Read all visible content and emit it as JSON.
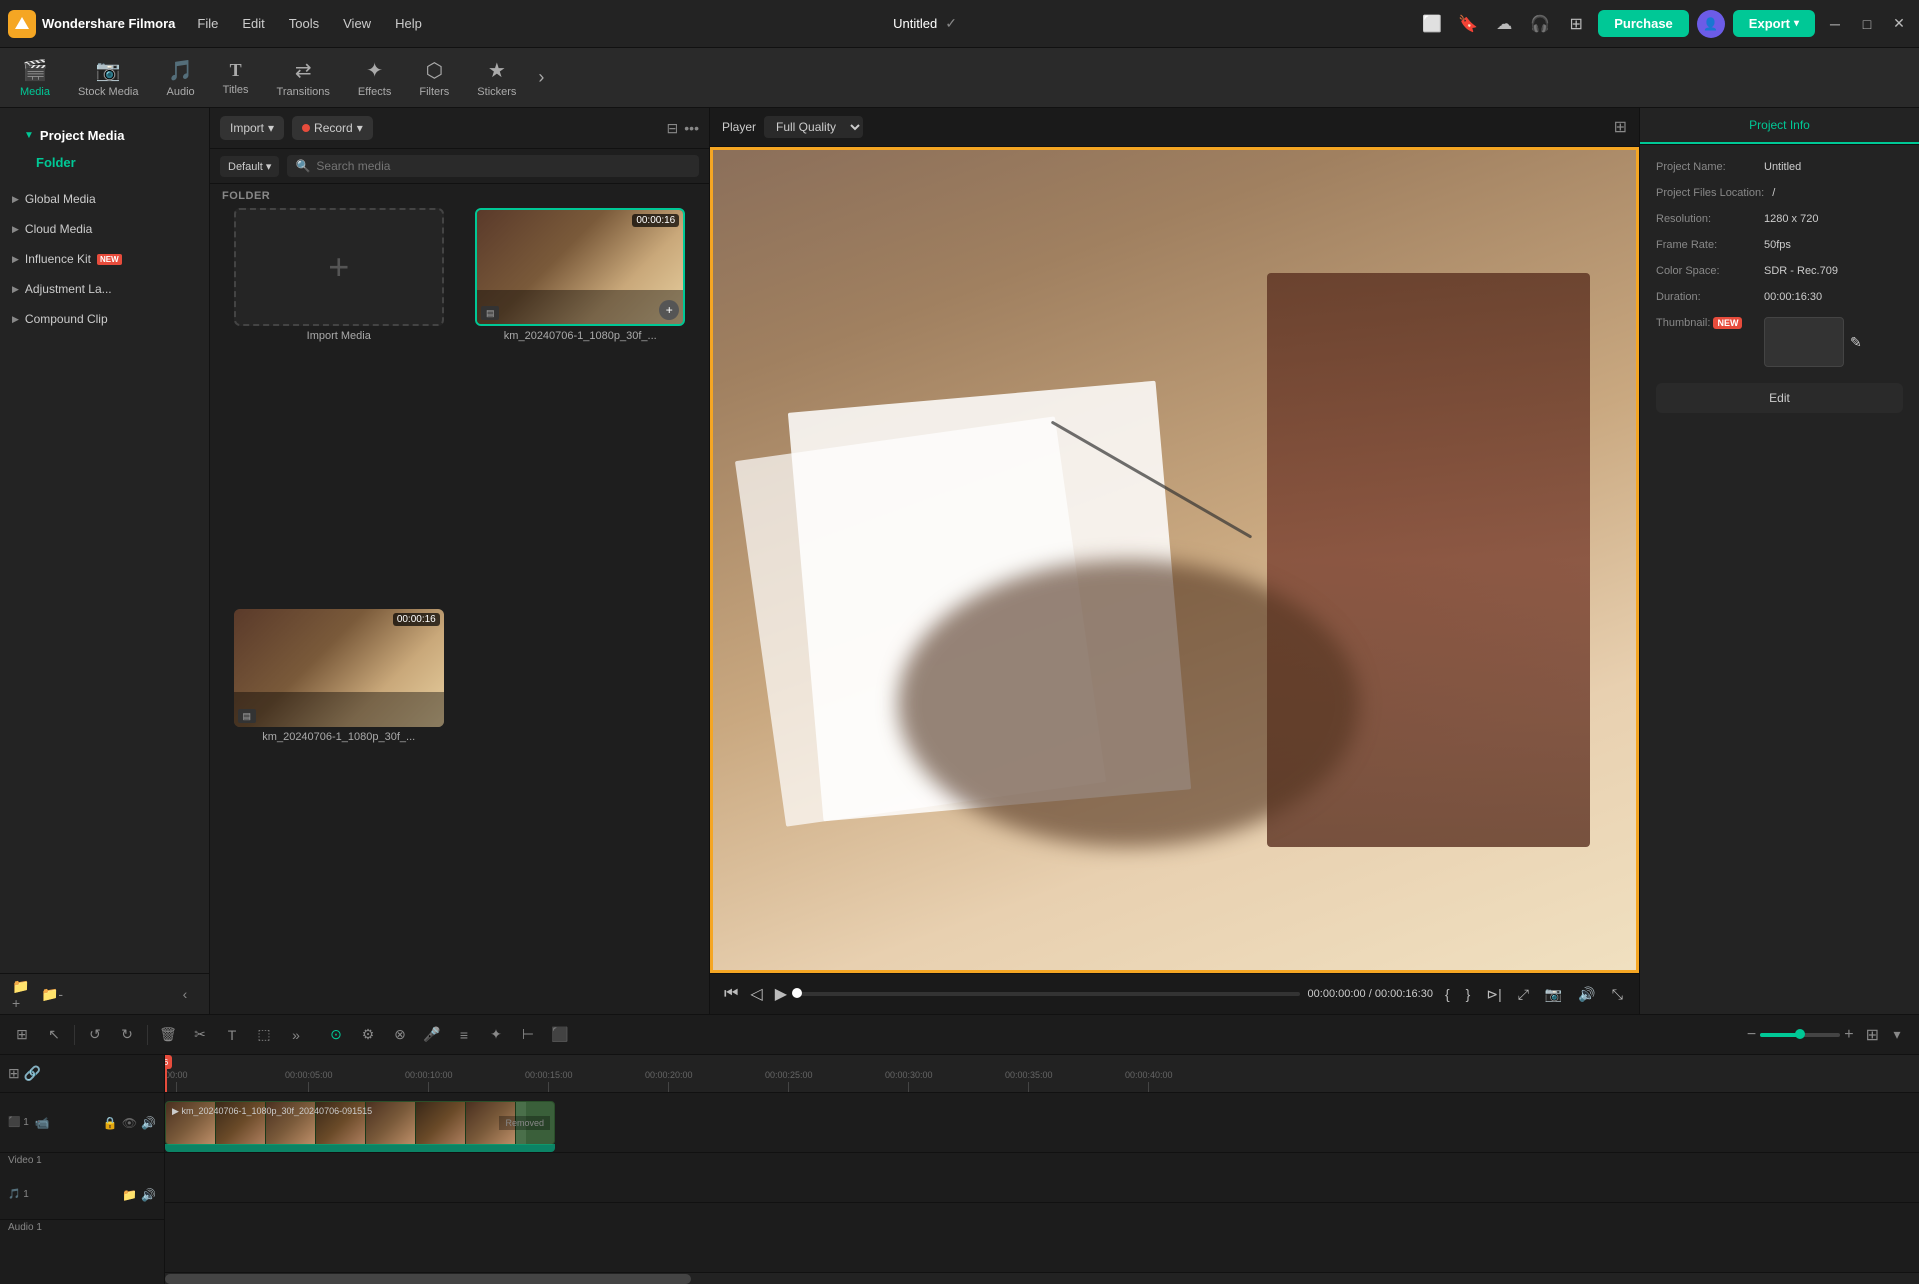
{
  "app": {
    "name": "Wondershare Filmora",
    "logo_letter": "F"
  },
  "menu": {
    "items": [
      "File",
      "Edit",
      "Tools",
      "View",
      "Help"
    ]
  },
  "title": {
    "project_name": "Untitled"
  },
  "topbar_right": {
    "purchase_label": "Purchase",
    "export_label": "Export"
  },
  "media_tabs": [
    {
      "id": "media",
      "label": "Media",
      "icon": "🎬"
    },
    {
      "id": "stock",
      "label": "Stock Media",
      "icon": "📷"
    },
    {
      "id": "audio",
      "label": "Audio",
      "icon": "🎵"
    },
    {
      "id": "titles",
      "label": "Titles",
      "icon": "T"
    },
    {
      "id": "transitions",
      "label": "Transitions",
      "icon": "↔"
    },
    {
      "id": "effects",
      "label": "Effects",
      "icon": "✦"
    },
    {
      "id": "filters",
      "label": "Filters",
      "icon": "⬡"
    },
    {
      "id": "stickers",
      "label": "Stickers",
      "icon": "★"
    }
  ],
  "left_panel": {
    "title": "Project Media",
    "folder_label": "Folder",
    "sections": [
      {
        "label": "Project Media",
        "active": true
      },
      {
        "label": "Global Media"
      },
      {
        "label": "Cloud Media"
      },
      {
        "label": "Influence Kit",
        "badge": "NEW"
      },
      {
        "label": "Adjustment La..."
      },
      {
        "label": "Compound Clip"
      }
    ]
  },
  "center_panel": {
    "import_label": "Import",
    "record_label": "Record",
    "default_label": "Default",
    "search_placeholder": "Search media",
    "folder_header": "FOLDER",
    "import_media_label": "Import Media",
    "media_items": [
      {
        "filename": "km_20240706-1_1080p_30f_...",
        "duration": "00:00:16",
        "has_thumb": true
      },
      {
        "filename": "km_20240706-1_1080p_30f_...",
        "duration": "00:00:16",
        "has_thumb": true
      }
    ]
  },
  "player": {
    "label": "Player",
    "quality": "Full Quality",
    "current_time": "00:00:00:00",
    "total_time": "00:00:16:30",
    "progress_percent": 0
  },
  "project_info": {
    "tab_label": "Project Info",
    "project_name_label": "Project Name:",
    "project_name_value": "Untitled",
    "files_location_label": "Project Files Location:",
    "files_location_value": "/",
    "resolution_label": "Resolution:",
    "resolution_value": "1280 x 720",
    "frame_rate_label": "Frame Rate:",
    "frame_rate_value": "50fps",
    "color_space_label": "Color Space:",
    "color_space_value": "SDR - Rec.709",
    "duration_label": "Duration:",
    "duration_value": "00:00:16:30",
    "thumbnail_label": "Thumbnail:",
    "edit_btn_label": "Edit"
  },
  "timeline": {
    "toolbar_buttons": [
      "group",
      "pointer",
      "undo",
      "redo",
      "delete",
      "cut",
      "text",
      "crop",
      "more"
    ],
    "tracks": [
      {
        "num": "1",
        "label": "Video 1",
        "type": "video"
      },
      {
        "num": "1",
        "label": "Audio 1",
        "type": "audio"
      }
    ],
    "ruler_marks": [
      "00:00",
      "00:00:05:00",
      "00:00:10:00",
      "00:00:15:00",
      "00:00:20:00",
      "00:00:25:00",
      "00:00:30:00",
      "00:00:35:00",
      "00:00:40:00"
    ],
    "clip": {
      "label": "km_20240706-1_1080p_30f_20240706-091515",
      "removed_label": "Removed"
    }
  }
}
